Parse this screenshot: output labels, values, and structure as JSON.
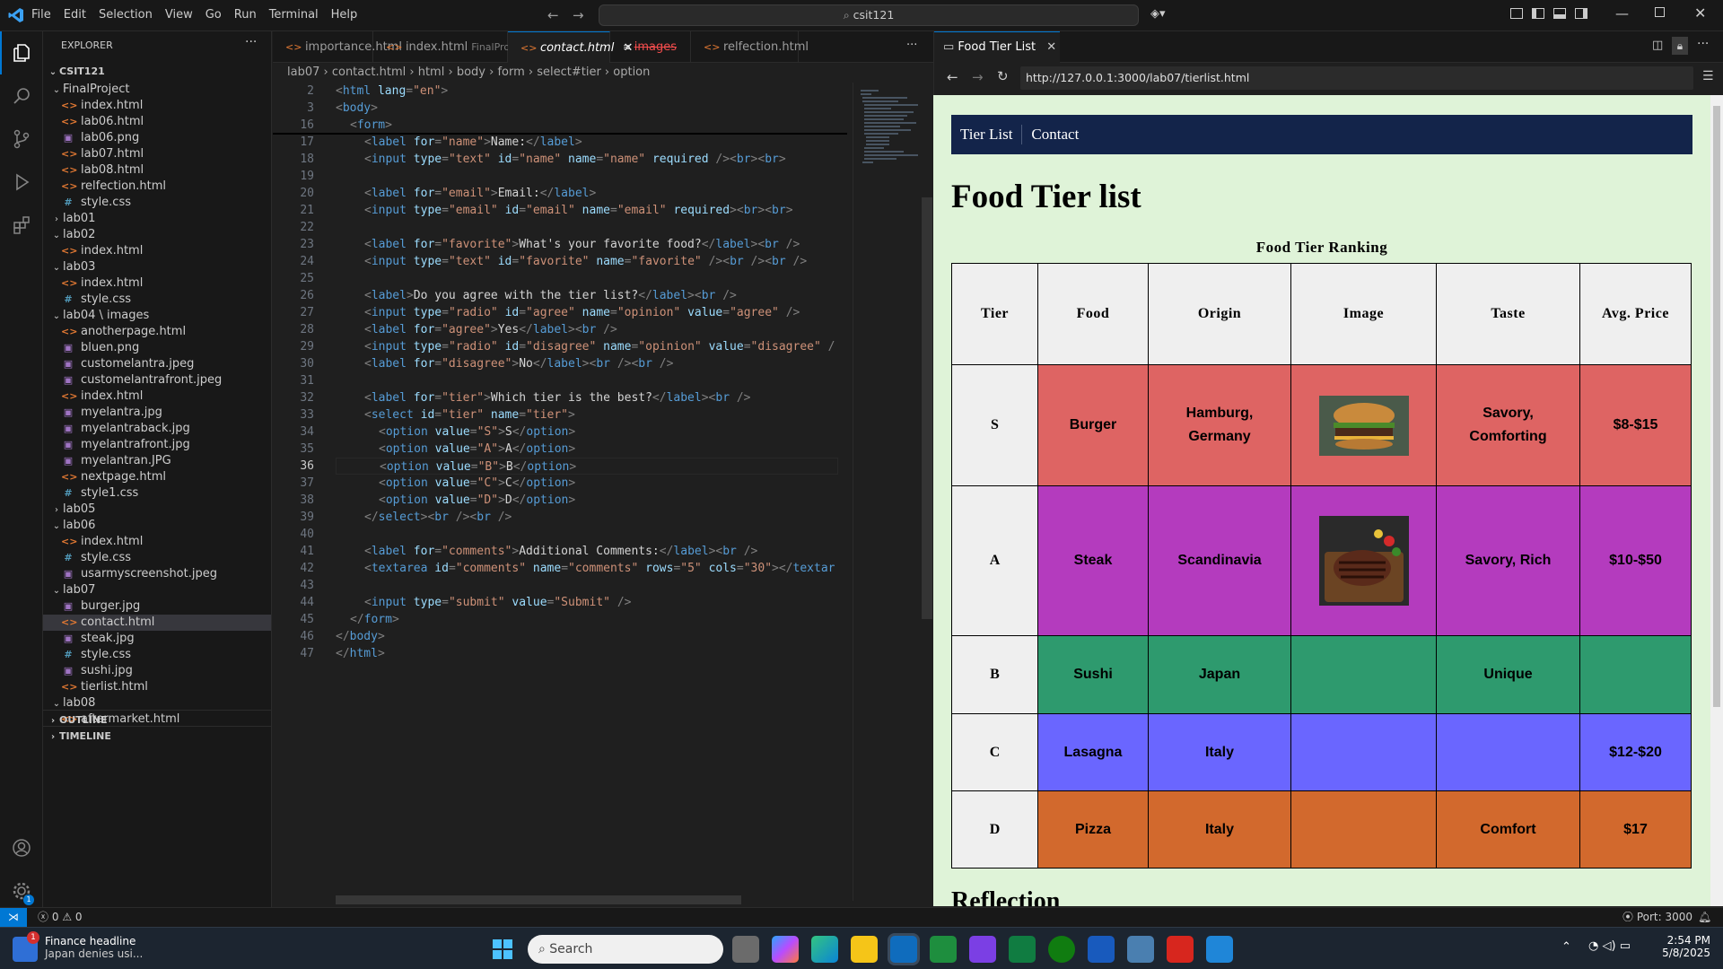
{
  "menu": [
    "File",
    "Edit",
    "Selection",
    "View",
    "Go",
    "Run",
    "Terminal",
    "Help"
  ],
  "search": {
    "text": "csit121"
  },
  "explorer": {
    "title": "EXPLORER",
    "root": "CSIT121",
    "items": [
      {
        "label": "FinalProject",
        "type": "folder-open",
        "depth": 1
      },
      {
        "label": "index.html",
        "type": "html",
        "depth": 2
      },
      {
        "label": "lab06.html",
        "type": "html",
        "depth": 2
      },
      {
        "label": "lab06.png",
        "type": "img",
        "depth": 2
      },
      {
        "label": "lab07.html",
        "type": "html",
        "depth": 2
      },
      {
        "label": "lab08.html",
        "type": "html",
        "depth": 2
      },
      {
        "label": "relfection.html",
        "type": "html",
        "depth": 2
      },
      {
        "label": "style.css",
        "type": "css",
        "depth": 2
      },
      {
        "label": "lab01",
        "type": "folder",
        "depth": 1
      },
      {
        "label": "lab02",
        "type": "folder-open",
        "depth": 1
      },
      {
        "label": "index.html",
        "type": "html",
        "depth": 2
      },
      {
        "label": "lab03",
        "type": "folder-open",
        "depth": 1
      },
      {
        "label": "index.html",
        "type": "html",
        "depth": 2
      },
      {
        "label": "style.css",
        "type": "css",
        "depth": 2
      },
      {
        "label": "lab04 \\ images",
        "type": "folder-open",
        "depth": 1
      },
      {
        "label": "anotherpage.html",
        "type": "html",
        "depth": 2
      },
      {
        "label": "bluen.png",
        "type": "img",
        "depth": 2
      },
      {
        "label": "customelantra.jpeg",
        "type": "img",
        "depth": 2
      },
      {
        "label": "customelantrafront.jpeg",
        "type": "img",
        "depth": 2
      },
      {
        "label": "index.html",
        "type": "html",
        "depth": 2
      },
      {
        "label": "myelantra.jpg",
        "type": "img",
        "depth": 2
      },
      {
        "label": "myelantraback.jpg",
        "type": "img",
        "depth": 2
      },
      {
        "label": "myelantrafront.jpg",
        "type": "img",
        "depth": 2
      },
      {
        "label": "myelantran.JPG",
        "type": "img",
        "depth": 2
      },
      {
        "label": "nextpage.html",
        "type": "html",
        "depth": 2
      },
      {
        "label": "style1.css",
        "type": "css",
        "depth": 2
      },
      {
        "label": "lab05",
        "type": "folder",
        "depth": 1
      },
      {
        "label": "lab06",
        "type": "folder-open",
        "depth": 1
      },
      {
        "label": "index.html",
        "type": "html",
        "depth": 2
      },
      {
        "label": "style.css",
        "type": "css",
        "depth": 2
      },
      {
        "label": "usarmyscreenshot.jpeg",
        "type": "img",
        "depth": 2
      },
      {
        "label": "lab07",
        "type": "folder-open",
        "depth": 1
      },
      {
        "label": "burger.jpg",
        "type": "img",
        "depth": 2
      },
      {
        "label": "contact.html",
        "type": "html",
        "depth": 2,
        "selected": true
      },
      {
        "label": "steak.jpg",
        "type": "img",
        "depth": 2
      },
      {
        "label": "style.css",
        "type": "css",
        "depth": 2
      },
      {
        "label": "sushi.jpg",
        "type": "img",
        "depth": 2
      },
      {
        "label": "tierlist.html",
        "type": "html",
        "depth": 2
      },
      {
        "label": "lab08",
        "type": "folder-open",
        "depth": 1
      },
      {
        "label": "aftermarket.html",
        "type": "html",
        "depth": 2
      }
    ],
    "outline": "OUTLINE",
    "timeline": "TIMELINE"
  },
  "tabs": [
    {
      "label": "importance.html",
      "icon": "<>"
    },
    {
      "label": "index.html",
      "sub": "FinalProject",
      "icon": "<>"
    },
    {
      "label": "contact.html",
      "icon": "<>",
      "active": true
    },
    {
      "label": "images",
      "icon": "≡"
    },
    {
      "label": "relfection.html",
      "icon": "<>"
    }
  ],
  "breadcrumb": [
    "lab07",
    "contact.html",
    "html",
    "body",
    "form",
    "select#tier",
    "option"
  ],
  "code": {
    "current_line": 36,
    "lines": [
      {
        "n": 2,
        "h": "<t><</t><tg>html</tg> <at>lang</at><t>=</t><st>\"en\"</st><t>></t>",
        "ind": 0
      },
      {
        "n": 3,
        "h": "<t><</t><tg>body</tg><t>></t>",
        "ind": 0
      },
      {
        "n": 16,
        "h": "<t><</t><tg>form</tg><t>></t>",
        "ind": 1
      },
      {
        "n": 17,
        "h": "<t><</t><tg>label</tg> <at>for</at><t>=</t><st>\"name\"</st><t>></t><tx>Name:</tx><t></</t><tg>label</tg><t>></t>",
        "ind": 2
      },
      {
        "n": 18,
        "h": "<t><</t><tg>input</tg> <at>type</at><t>=</t><st>\"text\"</st> <at>id</at><t>=</t><st>\"name\"</st> <at>name</at><t>=</t><st>\"name\"</st> <at>required</at> <t>/><</t><tg>br</tg><t>><</t><tg>br</tg><t>></t>",
        "ind": 2
      },
      {
        "n": 19,
        "h": "",
        "ind": 2
      },
      {
        "n": 20,
        "h": "<t><</t><tg>label</tg> <at>for</at><t>=</t><st>\"email\"</st><t>></t><tx>Email:</tx><t></</t><tg>label</tg><t>></t>",
        "ind": 2
      },
      {
        "n": 21,
        "h": "<t><</t><tg>input</tg> <at>type</at><t>=</t><st>\"email\"</st> <at>id</at><t>=</t><st>\"email\"</st> <at>name</at><t>=</t><st>\"email\"</st> <at>required</at><t>><</t><tg>br</tg><t>><</t><tg>br</tg><t>></t>",
        "ind": 2
      },
      {
        "n": 22,
        "h": "",
        "ind": 2
      },
      {
        "n": 23,
        "h": "<t><</t><tg>label</tg> <at>for</at><t>=</t><st>\"favorite\"</st><t>></t><tx>What's your favorite food?</tx><t></</t><tg>label</tg><t>><</t><tg>br</tg> <t>/></t>",
        "ind": 2
      },
      {
        "n": 24,
        "h": "<t><</t><tg>input</tg> <at>type</at><t>=</t><st>\"text\"</st> <at>id</at><t>=</t><st>\"favorite\"</st> <at>name</at><t>=</t><st>\"favorite\"</st> <t>/><</t><tg>br</tg> <t>/><</t><tg>br</tg> <t>/></t>",
        "ind": 2
      },
      {
        "n": 25,
        "h": "",
        "ind": 2
      },
      {
        "n": 26,
        "h": "<t><</t><tg>label</tg><t>></t><tx>Do you agree with the tier list?</tx><t></</t><tg>label</tg><t>><</t><tg>br</tg> <t>/></t>",
        "ind": 2
      },
      {
        "n": 27,
        "h": "<t><</t><tg>input</tg> <at>type</at><t>=</t><st>\"radio\"</st> <at>id</at><t>=</t><st>\"agree\"</st> <at>name</at><t>=</t><st>\"opinion\"</st> <at>value</at><t>=</t><st>\"agree\"</st> <t>/></t>",
        "ind": 2
      },
      {
        "n": 28,
        "h": "<t><</t><tg>label</tg> <at>for</at><t>=</t><st>\"agree\"</st><t>></t><tx>Yes</tx><t></</t><tg>label</tg><t>><</t><tg>br</tg> <t>/></t>",
        "ind": 2
      },
      {
        "n": 29,
        "h": "<t><</t><tg>input</tg> <at>type</at><t>=</t><st>\"radio\"</st> <at>id</at><t>=</t><st>\"disagree\"</st> <at>name</at><t>=</t><st>\"opinion\"</st> <at>value</at><t>=</t><st>\"disagree\"</st> <t>/</t>",
        "ind": 2
      },
      {
        "n": 30,
        "h": "<t><</t><tg>label</tg> <at>for</at><t>=</t><st>\"disagree\"</st><t>></t><tx>No</tx><t></</t><tg>label</tg><t>><</t><tg>br</tg> <t>/><</t><tg>br</tg> <t>/></t>",
        "ind": 2
      },
      {
        "n": 31,
        "h": "",
        "ind": 2
      },
      {
        "n": 32,
        "h": "<t><</t><tg>label</tg> <at>for</at><t>=</t><st>\"tier\"</st><t>></t><tx>Which tier is the best?</tx><t></</t><tg>label</tg><t>><</t><tg>br</tg> <t>/></t>",
        "ind": 2
      },
      {
        "n": 33,
        "h": "<t><</t><tg>select</tg> <at>id</at><t>=</t><st>\"tier\"</st> <at>name</at><t>=</t><st>\"tier\"</st><t>></t>",
        "ind": 2
      },
      {
        "n": 34,
        "h": "<t><</t><tg>option</tg> <at>value</at><t>=</t><st>\"S\"</st><t>></t><tx>S</tx><t></</t><tg>option</tg><t>></t>",
        "ind": 3
      },
      {
        "n": 35,
        "h": "<t><</t><tg>option</tg> <at>value</at><t>=</t><st>\"A\"</st><t>></t><tx>A</tx><t></</t><tg>option</tg><t>></t>",
        "ind": 3
      },
      {
        "n": 36,
        "h": "<t><</t><tg>option</tg> <at>value</at><t>=</t><st>\"B\"</st><t>></t><tx>B</tx><t></</t><tg>option</tg><t>></t>",
        "ind": 3
      },
      {
        "n": 37,
        "h": "<t><</t><tg>option</tg> <at>value</at><t>=</t><st>\"C\"</st><t>></t><tx>C</tx><t></</t><tg>option</tg><t>></t>",
        "ind": 3
      },
      {
        "n": 38,
        "h": "<t><</t><tg>option</tg> <at>value</at><t>=</t><st>\"D\"</st><t>></t><tx>D</tx><t></</t><tg>option</tg><t>></t>",
        "ind": 3
      },
      {
        "n": 39,
        "h": "<t></</t><tg>select</tg><t>><</t><tg>br</tg> <t>/><</t><tg>br</tg> <t>/></t>",
        "ind": 2
      },
      {
        "n": 40,
        "h": "",
        "ind": 2
      },
      {
        "n": 41,
        "h": "<t><</t><tg>label</tg> <at>for</at><t>=</t><st>\"comments\"</st><t>></t><tx>Additional Comments:</tx><t></</t><tg>label</tg><t>><</t><tg>br</tg> <t>/></t>",
        "ind": 2
      },
      {
        "n": 42,
        "h": "<t><</t><tg>textarea</tg> <at>id</at><t>=</t><st>\"comments\"</st> <at>name</at><t>=</t><st>\"comments\"</st> <at>rows</at><t>=</t><st>\"5\"</st> <at>cols</at><t>=</t><st>\"30\"</st><t>></</t><tg>textar</tg>",
        "ind": 2
      },
      {
        "n": 43,
        "h": "",
        "ind": 2
      },
      {
        "n": 44,
        "h": "<t><</t><tg>input</tg> <at>type</at><t>=</t><st>\"submit\"</st> <at>value</at><t>=</t><st>\"Submit\"</st> <t>/></t>",
        "ind": 2
      },
      {
        "n": 45,
        "h": "<t></</t><tg>form</tg><t>></t>",
        "ind": 1
      },
      {
        "n": 46,
        "h": "<t></</t><tg>body</tg><t>></t>",
        "ind": 0
      },
      {
        "n": 47,
        "h": "<t></</t><tg>html</tg><t>></t>",
        "ind": 0
      }
    ]
  },
  "browser": {
    "tab_title": "Food Tier List",
    "url": "http://127.0.0.1:3000/lab07/tierlist.html",
    "nav": [
      "Tier List",
      "Contact"
    ],
    "heading": "Food Tier list",
    "caption": "Food Tier Ranking",
    "headers": [
      "Tier",
      "Food",
      "Origin",
      "Image",
      "Taste",
      "Avg. Price"
    ],
    "rows": [
      {
        "tier": "S",
        "food": "Burger",
        "origin": "Hamburg, Germany",
        "image": "burger",
        "taste": "Savory, Comforting",
        "price": "$8-$15",
        "color": "#de6463"
      },
      {
        "tier": "A",
        "food": "Steak",
        "origin": "Scandinavia",
        "image": "steak",
        "taste": "Savory, Rich",
        "price": "$10-$50",
        "color": "#b43bbe"
      },
      {
        "tier": "B",
        "food": "Sushi",
        "origin": "Japan",
        "image": "",
        "taste": "Unique",
        "price": "",
        "color": "#2e9a6e"
      },
      {
        "tier": "C",
        "food": "Lasagna",
        "origin": "Italy",
        "image": "",
        "taste": "",
        "price": "$12-$20",
        "color": "#6a66ff"
      },
      {
        "tier": "D",
        "food": "Pizza",
        "origin": "Italy",
        "image": "",
        "taste": "Comfort",
        "price": "$17",
        "color": "#d2692d"
      }
    ],
    "reflection": "Reflection"
  },
  "status": {
    "errors": "0",
    "warnings": "0",
    "port": "Port: 3000"
  },
  "taskbar": {
    "news_title": "Finance headline",
    "news_sub": "Japan denies usi...",
    "search_placeholder": "Search",
    "time": "2:54 PM",
    "date": "5/8/2025"
  },
  "colors": {
    "accent": "#0078d4",
    "nav_bg": "#13244a",
    "page_bg": "#dff3d8"
  }
}
